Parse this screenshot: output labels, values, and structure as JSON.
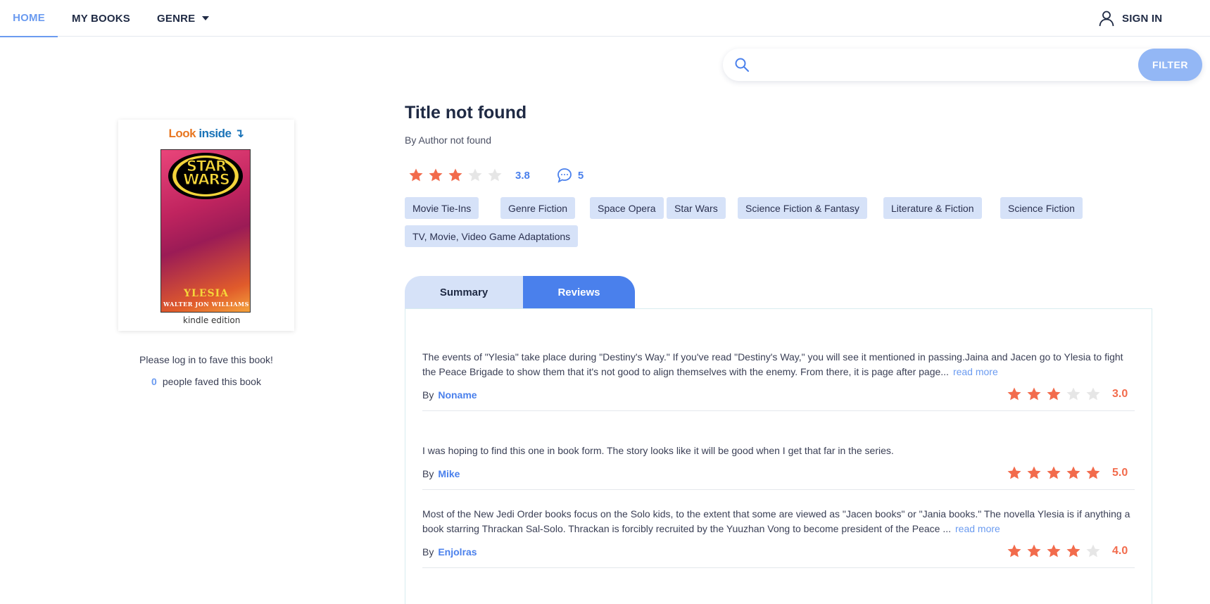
{
  "nav": {
    "home": "HOME",
    "my_books": "MY BOOKS",
    "genre": "GENRE",
    "sign_in": "SIGN IN"
  },
  "search": {
    "value": "",
    "placeholder": "",
    "filter_label": "FILTER"
  },
  "cover": {
    "look": "Look",
    "inside": "inside",
    "series_text": "STAR WARS",
    "book_name": "YLESIA",
    "cover_author": "WALTER JON WILLIAMS",
    "kindle_label": "kindle edition"
  },
  "fave": {
    "note": "Please log in to fave this book!",
    "count": "0",
    "count_label": "people faved this book"
  },
  "book": {
    "title": "Title not found",
    "author": "By Author not found",
    "rating": 3.8,
    "rating_label": "3.8",
    "comments": "5",
    "tags": [
      "Movie Tie-Ins",
      "Genre Fiction",
      "Space Opera",
      "Star Wars",
      "Science Fiction & Fantasy",
      "Literature & Fiction",
      "Science Fiction",
      "TV, Movie, Video Game Adaptations"
    ]
  },
  "tabs": {
    "summary": "Summary",
    "reviews": "Reviews"
  },
  "reviews": [
    {
      "text": "The events of \"Ylesia\" take place during \"Destiny's Way.\" If you've read \"Destiny's Way,\" you will see it mentioned in passing.Jaina and Jacen go to Ylesia to fight the Peace Brigade to show them that it's not good to align themselves with the enemy. From there, it is page after page...",
      "read_more": "read more",
      "by": "By",
      "name": "Noname",
      "stars": 3,
      "score": "3.0"
    },
    {
      "text": "I was hoping to find this one in book form. The story looks like it will be good when I get that far in the series.",
      "read_more": "",
      "by": "By",
      "name": "Mike",
      "stars": 5,
      "score": "5.0"
    },
    {
      "text": "Most of the New Jedi Order books focus on the Solo kids, to the extent that some are viewed as \"Jacen books\" or \"Jania books.\" The novella Ylesia is if anything a book starring Thrackan Sal-Solo. Thrackan is forcibly recruited by the Yuuzhan Vong to become president of the Peace ...",
      "read_more": "read more",
      "by": "By",
      "name": "Enjolras",
      "stars": 4,
      "score": "4.0"
    }
  ],
  "icons": {
    "search": "search-icon",
    "user": "user-icon",
    "comment": "comment-icon",
    "star": "star-icon",
    "caret": "chevron-down-icon"
  },
  "colors": {
    "accent": "#4a80ec",
    "accent_light": "#6b9bf0",
    "tag_bg": "#d6e2f8",
    "star_filled": "#f26b4c",
    "star_empty": "#e6e6e6",
    "text_dark": "#1f2a44"
  }
}
